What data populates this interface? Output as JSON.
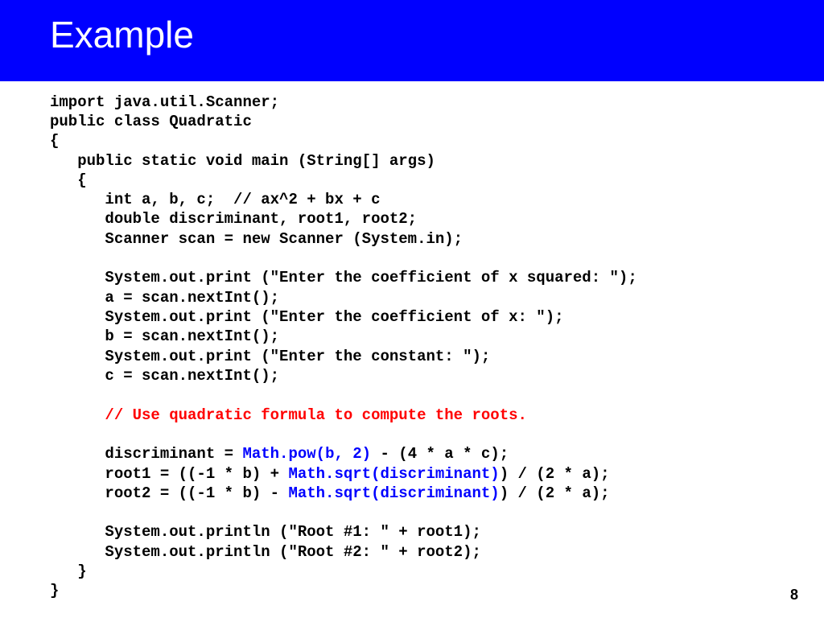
{
  "header": {
    "title": "Example"
  },
  "code": {
    "l01": "import java.util.Scanner;",
    "l02": "public class Quadratic",
    "l03": "{",
    "l04": "   public static void main (String[] args)",
    "l05": "   {",
    "l06": "      int a, b, c;  // ax^2 + bx + c",
    "l07": "      double discriminant, root1, root2;",
    "l08": "      Scanner scan = new Scanner (System.in);",
    "blank1": "",
    "l09": "      System.out.print (\"Enter the coefficient of x squared: \");",
    "l10": "      a = scan.nextInt();",
    "l11": "      System.out.print (\"Enter the coefficient of x: \");",
    "l12": "      b = scan.nextInt();",
    "l13": "      System.out.print (\"Enter the constant: \");",
    "l14": "      c = scan.nextInt();",
    "blank2": "",
    "l15": "      // Use quadratic formula to compute the roots.",
    "blank3": "",
    "l16a": "      discriminant = ",
    "l16b": "Math.pow(b, 2)",
    "l16c": " - (4 * a * c);",
    "l17a": "      root1 = ((-1 * b) + ",
    "l17b": "Math.sqrt(discriminant)",
    "l17c": ") / (2 * a);",
    "l18a": "      root2 = ((-1 * b) - ",
    "l18b": "Math.sqrt(discriminant)",
    "l18c": ") / (2 * a);",
    "blank4": "",
    "l19": "      System.out.println (\"Root #1: \" + root1);",
    "l20": "      System.out.println (\"Root #2: \" + root2);",
    "l21": "   }",
    "l22": "}"
  },
  "pageNumber": "8"
}
